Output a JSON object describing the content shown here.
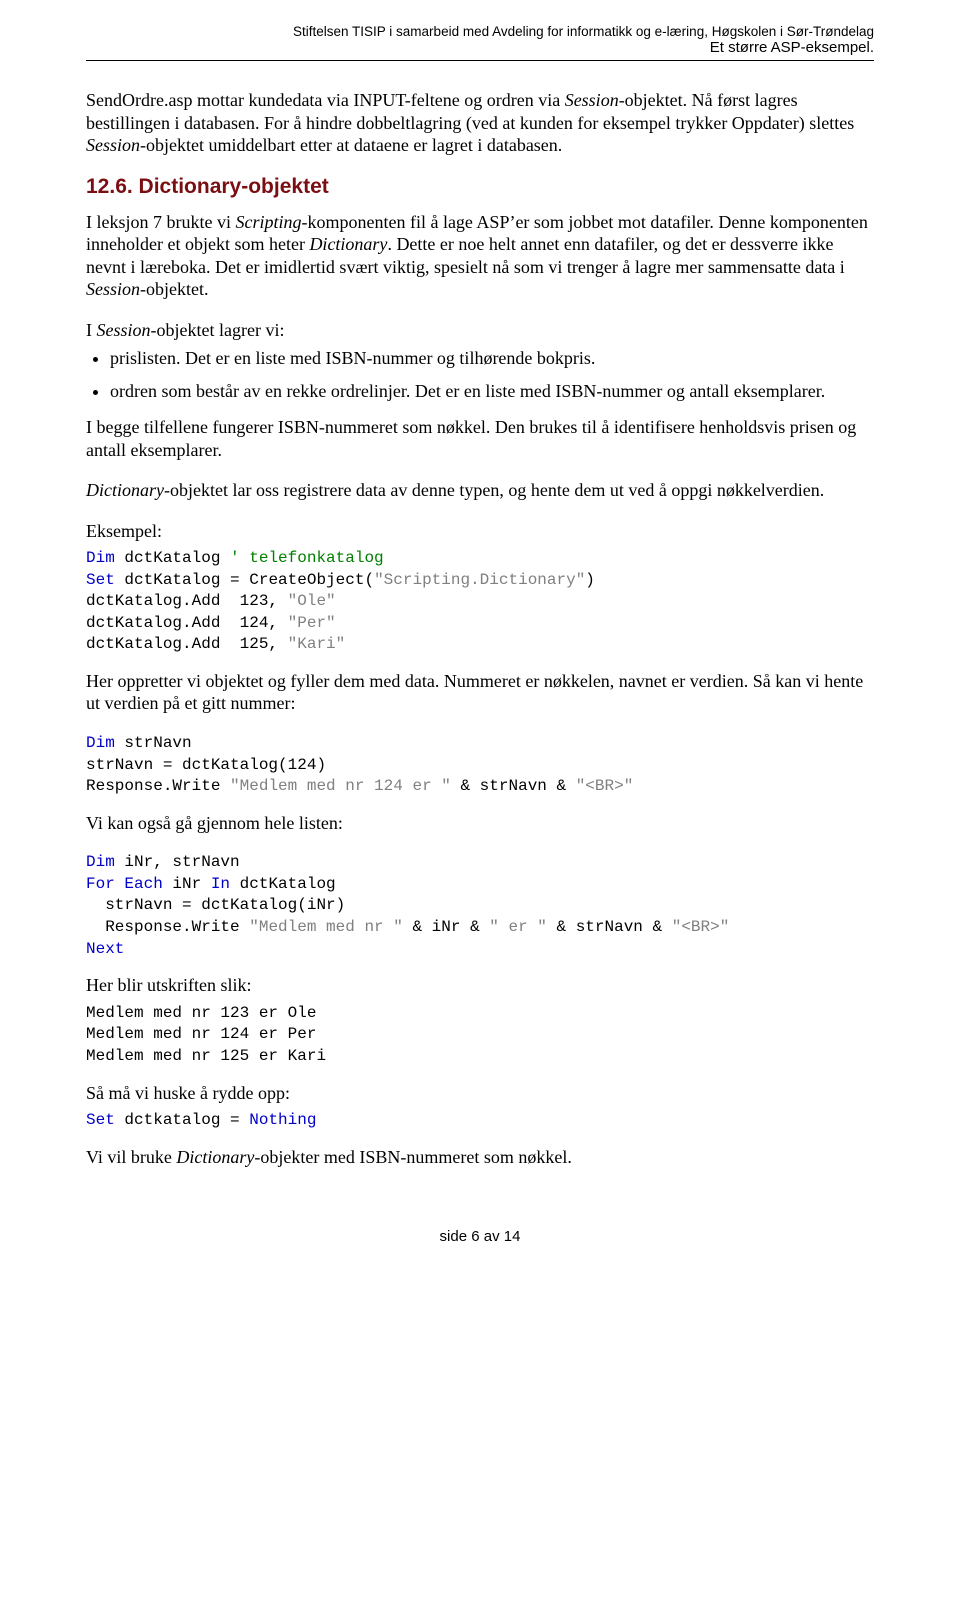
{
  "header": {
    "line1": "Stiftelsen TISIP i samarbeid med Avdeling for informatikk og e-læring, Høgskolen i Sør-Trøndelag",
    "line2": "Et større ASP-eksempel."
  },
  "para1_a": "SendOrdre.asp mottar kundedata via INPUT-feltene og ordren via ",
  "para1_b": "Session",
  "para1_c": "-objektet. Nå først lagres bestillingen i databasen. For å hindre dobbeltlagring (ved at kunden for eksempel trykker Oppdater) slettes ",
  "para1_d": "Session",
  "para1_e": "-objektet umiddelbart etter at dataene er lagret i databasen.",
  "section_heading": "12.6. Dictionary-objektet",
  "para2_a": "I leksjon 7 brukte vi ",
  "para2_b": "Scripting",
  "para2_c": "-komponenten fil å lage ASP’er som jobbet mot datafiler. Denne komponenten inneholder et objekt som heter ",
  "para2_d": "Dictionary",
  "para2_e": ". Dette er noe helt annet enn datafiler, og det er dessverre ikke nevnt i læreboka. Det er imidlertid svært viktig, spesielt nå som vi trenger å lagre mer sammensatte data i ",
  "para2_f": "Session",
  "para2_g": "-objektet.",
  "para3_a": "I ",
  "para3_b": "Session",
  "para3_c": "-objektet lagrer vi:",
  "bullets": {
    "b1": "prislisten. Det er en liste med ISBN-nummer og tilhørende bokpris.",
    "b2": "ordren som består av en rekke ordrelinjer. Det er en liste med ISBN-nummer og antall eksemplarer."
  },
  "para4": "I begge tilfellene fungerer ISBN-nummeret som nøkkel. Den brukes til å identifisere henholdsvis prisen og antall eksemplarer.",
  "para5_a": "Dictionary",
  "para5_b": "-objektet lar oss registrere data av denne typen, og hente dem ut ved å oppgi nøkkelverdien.",
  "para6": "Eksempel:",
  "code1": {
    "l1a": "Dim",
    "l1b": " dctKatalog ",
    "l1c": "' telefonkatalog",
    "l2a": "Set",
    "l2b": " dctKatalog = CreateObject(",
    "l2c": "\"Scripting.Dictionary\"",
    "l2d": ")",
    "l3a": "dctKatalog.Add  123, ",
    "l3b": "\"Ole\"",
    "l4a": "dctKatalog.Add  124, ",
    "l4b": "\"Per\"",
    "l5a": "dctKatalog.Add  125, ",
    "l5b": "\"Kari\""
  },
  "para7": "Her oppretter vi objektet og fyller dem med data. Nummeret er nøkkelen, navnet er verdien. Så kan vi hente ut verdien på et gitt nummer:",
  "code2": {
    "l1a": "Dim",
    "l1b": " strNavn",
    "l2": "strNavn = dctKatalog(124)",
    "l3a": "Response.Write ",
    "l3b": "\"Medlem med nr 124 er \"",
    "l3c": " & strNavn & ",
    "l3d": "\"<BR>\""
  },
  "para8": "Vi kan også gå gjennom hele listen:",
  "code3": {
    "l1a": "Dim",
    "l1b": " iNr, strNavn",
    "l2a": "For Each",
    "l2b": " iNr ",
    "l2c": "In",
    "l2d": " dctKatalog",
    "l3": "  strNavn = dctKatalog(iNr)",
    "l4a": "  Response.Write ",
    "l4b": "\"Medlem med nr \"",
    "l4c": " & iNr & ",
    "l4d": "\" er \"",
    "l4e": " & strNavn & ",
    "l4f": "\"<BR>\"",
    "l5": "Next"
  },
  "para9": "Her blir utskriften slik:",
  "code4": {
    "l1": "Medlem med nr 123 er Ole",
    "l2": "Medlem med nr 124 er Per",
    "l3": "Medlem med nr 125 er Kari"
  },
  "para10": "Så må vi huske å rydde opp:",
  "code5": {
    "l1a": "Set",
    "l1b": " dctkatalog = ",
    "l1c": "Nothing"
  },
  "para11_a": "Vi vil bruke ",
  "para11_b": "Dictionary",
  "para11_c": "-objekter med ISBN-nummeret som nøkkel.",
  "footer": "side 6 av 14"
}
